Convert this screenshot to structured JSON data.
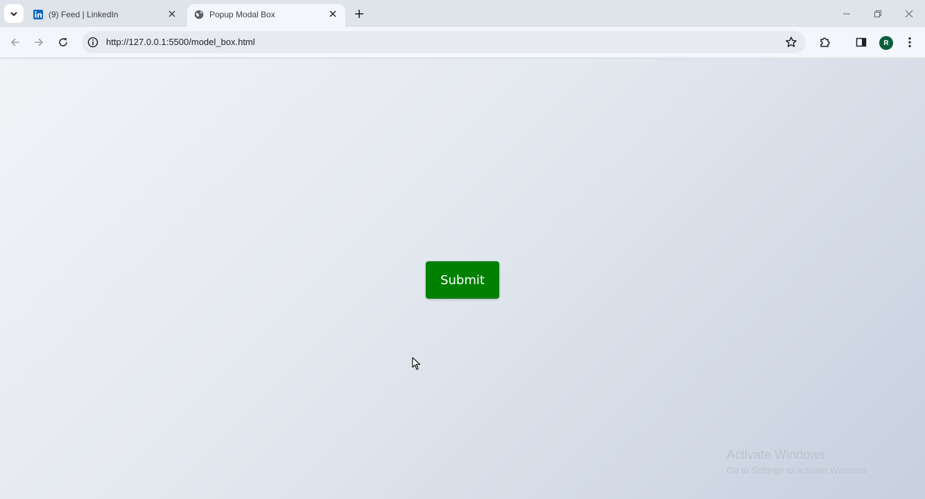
{
  "browser": {
    "tabs": [
      {
        "title": "(9) Feed | LinkedIn",
        "favicon": "linkedin-icon",
        "active": false
      },
      {
        "title": "Popup Modal Box",
        "favicon": "globe-icon",
        "active": true
      }
    ],
    "url": "http://127.0.0.1:5500/model_box.html",
    "profile_initial": "R"
  },
  "page": {
    "submit_label": "Submit",
    "button_color": "#008000"
  },
  "watermark": {
    "line1": "Activate Windows",
    "line2": "Go to Settings to activate Windows."
  }
}
